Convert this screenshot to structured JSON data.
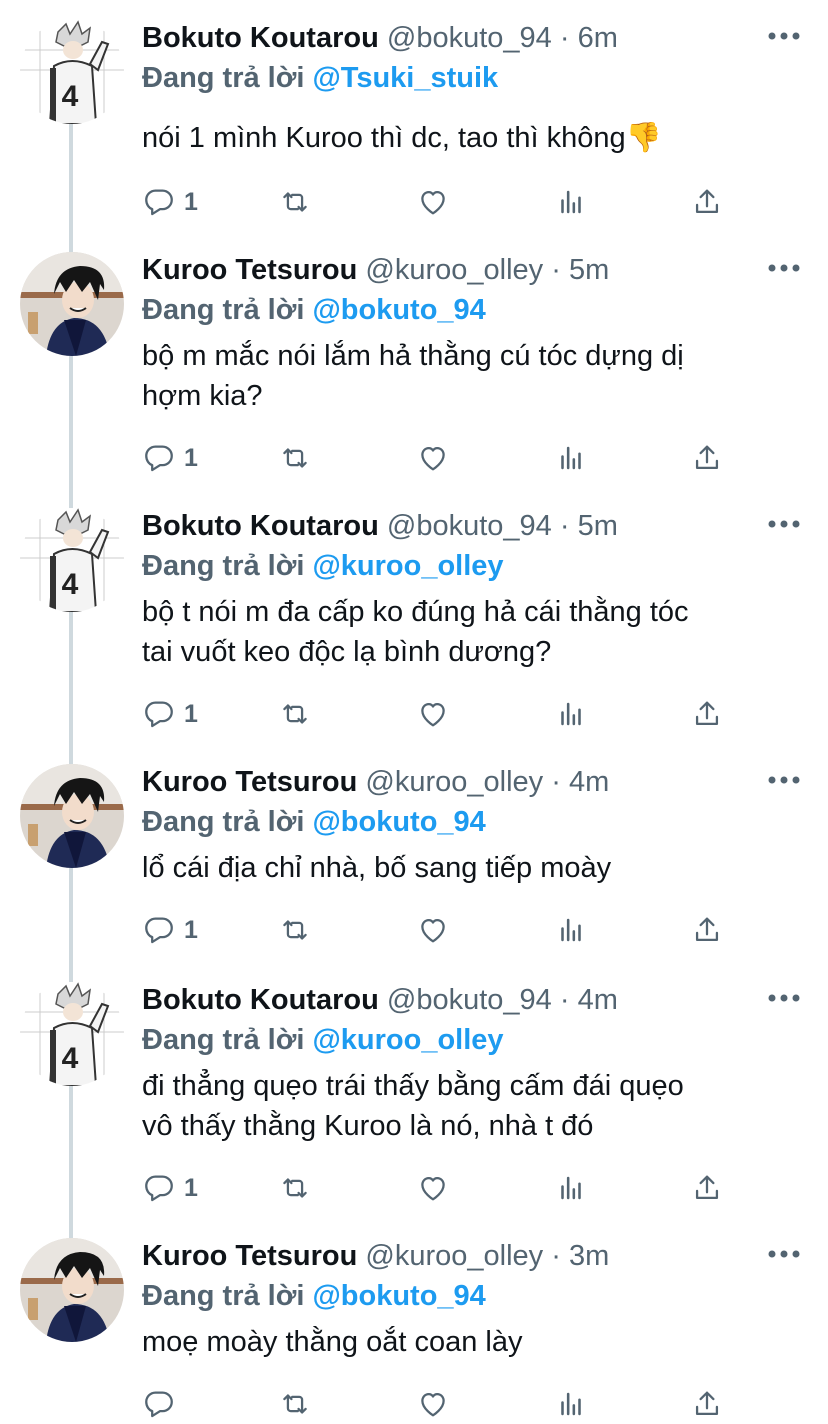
{
  "reply_prefix": "Đang trả lời",
  "tweets": [
    {
      "author": "Bokuto Koutarou",
      "handle": "@bokuto_94",
      "time": "6m",
      "reply_to": "@Tsuki_stuik",
      "lines": [
        "nói 1 mình Kuroo thì dc, tao thì không👎"
      ],
      "replies": "1",
      "avatar": "bokuto-avatar"
    },
    {
      "author": "Kuroo Tetsurou",
      "handle": "@kuroo_olley",
      "time": "5m",
      "reply_to": "@bokuto_94",
      "lines": [
        "bộ m mắc nói lắm hả thằng cú tóc dựng dị",
        "hợm kia?"
      ],
      "replies": "1",
      "avatar": "kuroo-avatar"
    },
    {
      "author": "Bokuto Koutarou",
      "handle": "@bokuto_94",
      "time": "5m",
      "reply_to": "@kuroo_olley",
      "lines": [
        "bộ t nói m đa cấp ko đúng hả cái thằng tóc",
        "tai vuốt keo độc lạ bình dương?"
      ],
      "replies": "1",
      "avatar": "bokuto-avatar"
    },
    {
      "author": "Kuroo Tetsurou",
      "handle": "@kuroo_olley",
      "time": "4m",
      "reply_to": "@bokuto_94",
      "lines": [
        "lổ cái địa chỉ nhà, bố sang tiếp moày"
      ],
      "replies": "1",
      "avatar": "kuroo-avatar"
    },
    {
      "author": "Bokuto Koutarou",
      "handle": "@bokuto_94",
      "time": "4m",
      "reply_to": "@kuroo_olley",
      "lines": [
        "đi thẳng quẹo trái thấy bằng cấm đái quẹo",
        "vô thấy thằng Kuroo là nó, nhà t đó"
      ],
      "replies": "1",
      "avatar": "bokuto-avatar"
    },
    {
      "author": "Kuroo Tetsurou",
      "handle": "@kuroo_olley",
      "time": "3m",
      "reply_to": "@bokuto_94",
      "lines": [
        "moẹ moày thằng oắt coan lày"
      ],
      "replies": "",
      "avatar": "kuroo-avatar"
    }
  ],
  "colors": {
    "text": "#0f1419",
    "muted": "#536471",
    "accent": "#1d9bf0",
    "line": "#cfd9de"
  }
}
